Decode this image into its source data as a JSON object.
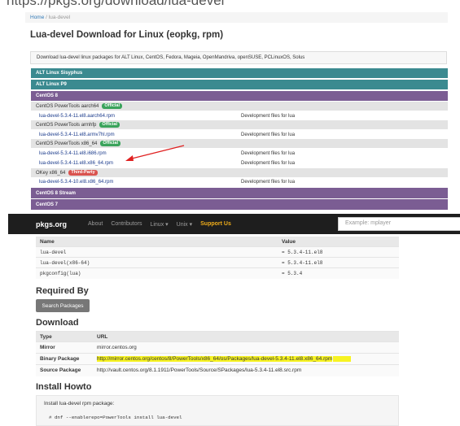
{
  "url": "https://pkgs.org/download/lua-devel",
  "breadcrumb": {
    "home": "Home",
    "sep": "/",
    "current": "lua-devel"
  },
  "title": "Lua-devel Download for Linux (eopkg, rpm)",
  "info": "Download lua-devel linux packages for ALT Linux, CentOS, Fedora, Mageia, OpenMandriva, openSUSE, PCLinuxOS, Solus",
  "distros": {
    "alt_sisyphus": "ALT Linux Sisyphus",
    "alt_p9": "ALT Linux P9",
    "centos8": "CentOS 8",
    "centos8_stream": "CentOS 8 Stream",
    "centos7": "CentOS 7"
  },
  "repos": {
    "aarch64": {
      "name": "CentOS PowerTools aarch64",
      "badge": "Official"
    },
    "armhfp": {
      "name": "CentOS PowerTools armhfp",
      "badge": "Official"
    },
    "x86_64": {
      "name": "CentOS PowerTools x86_64",
      "badge": "Official"
    },
    "okey": {
      "name": "OKey x86_64",
      "badge": "Third-Party"
    }
  },
  "packages": [
    {
      "name": "lua-devel-5.3.4-11.el8.aarch64.rpm",
      "desc": "Development files for lua"
    },
    {
      "name": "lua-devel-5.3.4-11.el8.armv7hl.rpm",
      "desc": "Development files for lua"
    },
    {
      "name": "lua-devel-5.3.4-11.el8.i686.rpm",
      "desc": "Development files for lua"
    },
    {
      "name": "lua-devel-5.3.4-11.el8.x86_64.rpm",
      "desc": "Development files for lua"
    },
    {
      "name": "lua-devel-5.3.4-10.el8.x86_64.rpm",
      "desc": "Development files for lua"
    }
  ],
  "navbar": {
    "logo": "pkgs.org",
    "about": "About",
    "contributors": "Contributors",
    "linux": "Linux ▾",
    "unix": "Unix ▾",
    "support": "Support Us",
    "search_placeholder": "Example: mplayer"
  },
  "provides": {
    "headers": [
      "Name",
      "Value"
    ],
    "rows": [
      [
        "lua-devel",
        "= 5.3.4-11.el8"
      ],
      [
        "lua-devel(x86-64)",
        "= 5.3.4-11.el8"
      ],
      [
        "pkgconfig(lua)",
        "= 5.3.4"
      ]
    ]
  },
  "required_by": {
    "heading": "Required By",
    "button": "Search Packages"
  },
  "download": {
    "heading": "Download",
    "headers": [
      "Type",
      "URL"
    ],
    "rows": [
      [
        "Mirror",
        "mirror.centos.org"
      ],
      [
        "Binary Package",
        "http://mirror.centos.org/centos/8/PowerTools/x86_64/os/Packages/lua-devel-5.3.4-11.el8.x86_64.rpm"
      ],
      [
        "Source Package",
        "http://vault.centos.org/8.1.1911/PowerTools/Source/SPackages/lua-5.3.4-11.el8.src.rpm"
      ]
    ]
  },
  "install": {
    "heading": "Install Howto",
    "text": "Install lua-devel rpm package:",
    "command": "# dnf --enablerepo=PowerTools install lua-devel"
  },
  "colors": {
    "teal": "#3b8a90",
    "purple": "#7b5d93",
    "highlight": "#f7f322",
    "arrow": "#e02020"
  }
}
